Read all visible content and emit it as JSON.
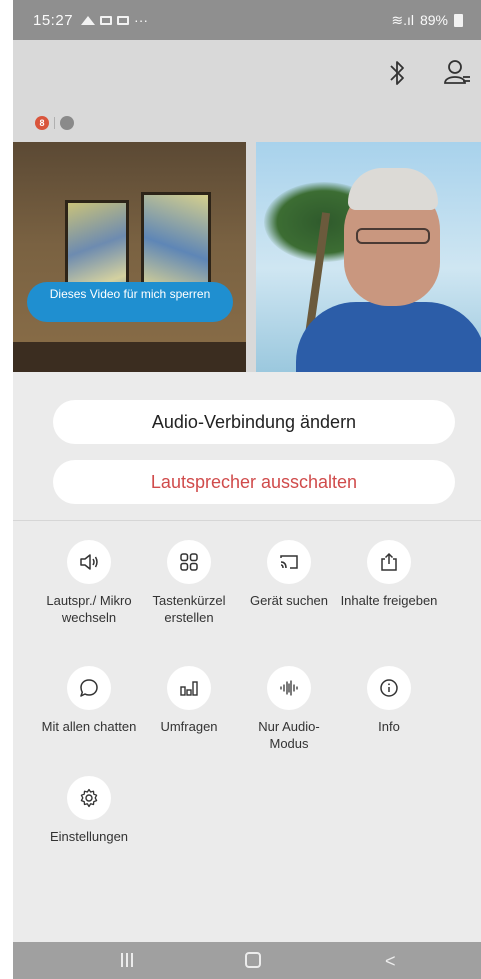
{
  "status_bar": {
    "time": "15:27",
    "dots": "···",
    "signal": "≋.ıl",
    "battery_percent": "89%"
  },
  "meeting": {
    "indicator_badge": "8",
    "video_left_overlay_label": "Dieses Video für mich sperren"
  },
  "actions": {
    "change_audio_label": "Audio-Verbindung ändern",
    "mute_speaker_label": "Lautsprecher ausschalten"
  },
  "grid": {
    "switch_speaker": "Lautspr./ Mikro wechseln",
    "shortcut": "Tastenkürzel erstellen",
    "find_device": "Gerät suchen",
    "share_content": "Inhalte freigeben",
    "chat_all": "Mit allen chatten",
    "polls": "Umfragen",
    "audio_only": "Nur Audio-Modus",
    "info": "Info",
    "settings": "Einstellungen"
  },
  "colors": {
    "accent_blue": "#1f8fd0",
    "speaker_red": "#d04b4b"
  }
}
